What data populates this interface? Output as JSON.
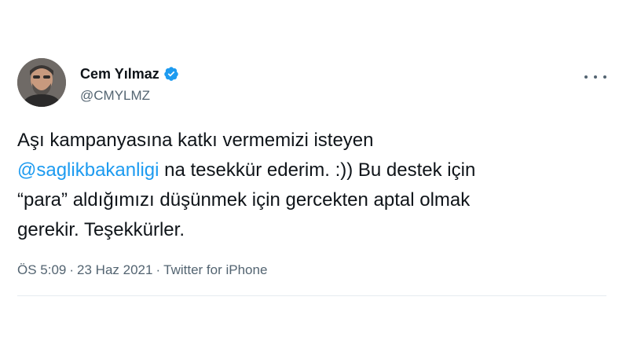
{
  "author": {
    "display_name": "Cem Yılmaz",
    "handle": "@CMYLMZ",
    "verified": true
  },
  "tweet": {
    "line1": "Aşı kampanyasına katkı vermemizi isteyen",
    "mention": "@saglikbakanligi",
    "line2_rest": " na tesekkür ederim. :)) Bu destek için",
    "line3": "“para” aldığımızı düşünmek için gercekten aptal olmak",
    "line4": "gerekir. Teşekkürler."
  },
  "meta": {
    "time": "ÖS 5:09",
    "separator": "·",
    "date": "23 Haz 2021",
    "source": "Twitter for iPhone"
  },
  "colors": {
    "link": "#1d9bf0",
    "secondary_text": "#536471"
  }
}
